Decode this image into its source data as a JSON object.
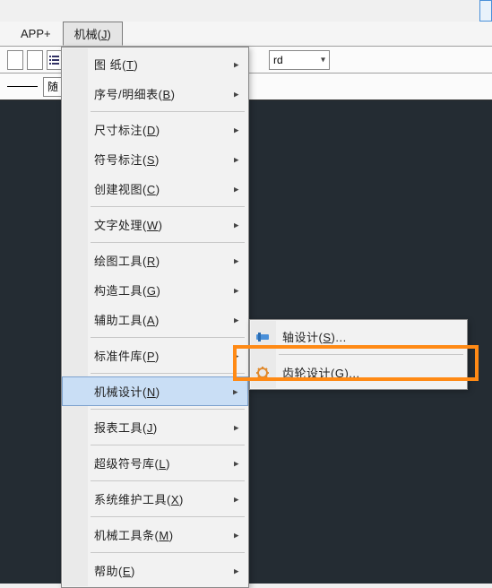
{
  "top_tiny": "",
  "menubar": {
    "app_plus": "APP+",
    "mech": {
      "label": "机械(",
      "hotkey": "J",
      "tail": ")"
    }
  },
  "toolbar": {
    "dd1": "rd",
    "linelabel": "随"
  },
  "menu": {
    "items": [
      {
        "label": "图    纸(",
        "hk": "T",
        "tail": ")",
        "arrow": true
      },
      {
        "label": "序号/明细表(",
        "hk": "B",
        "tail": ")",
        "arrow": true
      },
      {
        "label": "尺寸标注(",
        "hk": "D",
        "tail": ")",
        "arrow": true
      },
      {
        "label": "符号标注(",
        "hk": "S",
        "tail": ")",
        "arrow": true
      },
      {
        "label": "创建视图(",
        "hk": "C",
        "tail": ")",
        "arrow": true
      },
      {
        "label": "文字处理(",
        "hk": "W",
        "tail": ")",
        "arrow": true
      },
      {
        "label": "绘图工具(",
        "hk": "R",
        "tail": ")",
        "arrow": true
      },
      {
        "label": "构造工具(",
        "hk": "G",
        "tail": ")",
        "arrow": true
      },
      {
        "label": "辅助工具(",
        "hk": "A",
        "tail": ")",
        "arrow": true
      },
      {
        "label": "标准件库(",
        "hk": "P",
        "tail": ")",
        "arrow": true
      },
      {
        "label": "机械设计(",
        "hk": "N",
        "tail": ")",
        "arrow": true,
        "active": true
      },
      {
        "label": "报表工具(",
        "hk": "J",
        "tail": ")",
        "arrow": true
      },
      {
        "label": "超级符号库(",
        "hk": "L",
        "tail": ")",
        "arrow": true
      },
      {
        "label": "系统维护工具(",
        "hk": "X",
        "tail": ")",
        "arrow": true
      },
      {
        "label": "机械工具条(",
        "hk": "M",
        "tail": ")",
        "arrow": true
      },
      {
        "label": "帮助(",
        "hk": "E",
        "tail": ")",
        "arrow": true
      }
    ],
    "separators_after": [
      1,
      4,
      5,
      8,
      9,
      10,
      11,
      12,
      13,
      14
    ]
  },
  "submenu": {
    "items": [
      {
        "icon": "shaft-icon",
        "label": "轴设计(",
        "hk": "S",
        "tail": ")..."
      },
      {
        "icon": "gear-icon",
        "label": "齿轮设计(",
        "hk": "G",
        "tail": ")..."
      }
    ],
    "separators_after": [
      0
    ]
  }
}
